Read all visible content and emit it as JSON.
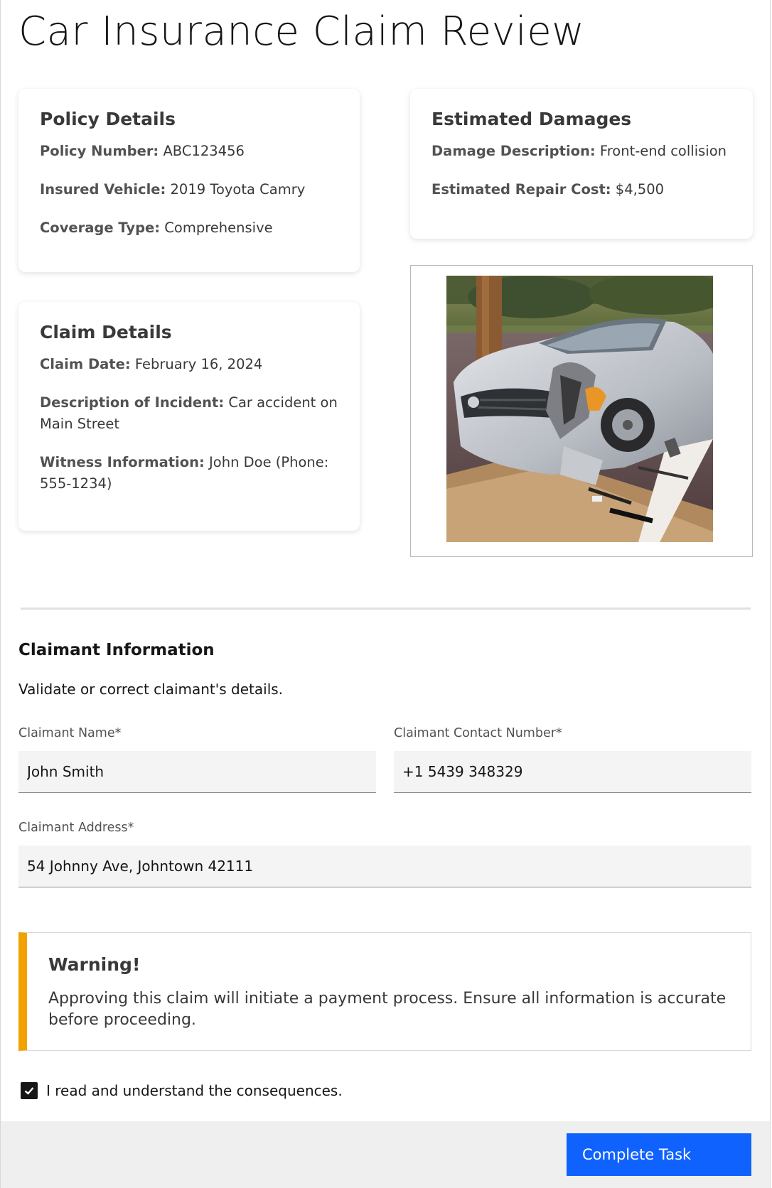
{
  "page": {
    "title": "Car Insurance Claim Review"
  },
  "policy": {
    "heading": "Policy Details",
    "rows": [
      {
        "label": "Policy Number:",
        "value": "ABC123456"
      },
      {
        "label": "Insured Vehicle:",
        "value": "2019 Toyota Camry"
      },
      {
        "label": "Coverage Type:",
        "value": "Comprehensive"
      }
    ]
  },
  "damages": {
    "heading": "Estimated Damages",
    "rows": [
      {
        "label": "Damage Description:",
        "value": "Front-end collision"
      },
      {
        "label": "Estimated Repair Cost:",
        "value": "$4,500"
      }
    ]
  },
  "claim": {
    "heading": "Claim Details",
    "rows": [
      {
        "label": "Claim Date:",
        "value": "February 16, 2024"
      },
      {
        "label": "Description of Incident:",
        "value": "Car accident on Main Street"
      },
      {
        "label": "Witness Information:",
        "value": "John Doe (Phone: 555-1234)"
      }
    ]
  },
  "claimant": {
    "heading": "Claimant Information",
    "description": "Validate or correct claimant's details.",
    "name_label": "Claimant Name*",
    "name_value": "John Smith",
    "contact_label": "Claimant Contact Number*",
    "contact_value": "+1 5439 348329",
    "address_label": "Claimant Address*",
    "address_value": "54 Johnny Ave, Johntown 42111"
  },
  "warning": {
    "title": "Warning!",
    "text": "Approving this claim will initiate a payment process. Ensure all information is accurate before proceeding.",
    "accent_color": "#f1a100"
  },
  "acknowledge": {
    "label": "I read and understand the consequences.",
    "checked": true
  },
  "footer": {
    "button_label": "Complete Task",
    "button_color": "#0f62fe"
  }
}
